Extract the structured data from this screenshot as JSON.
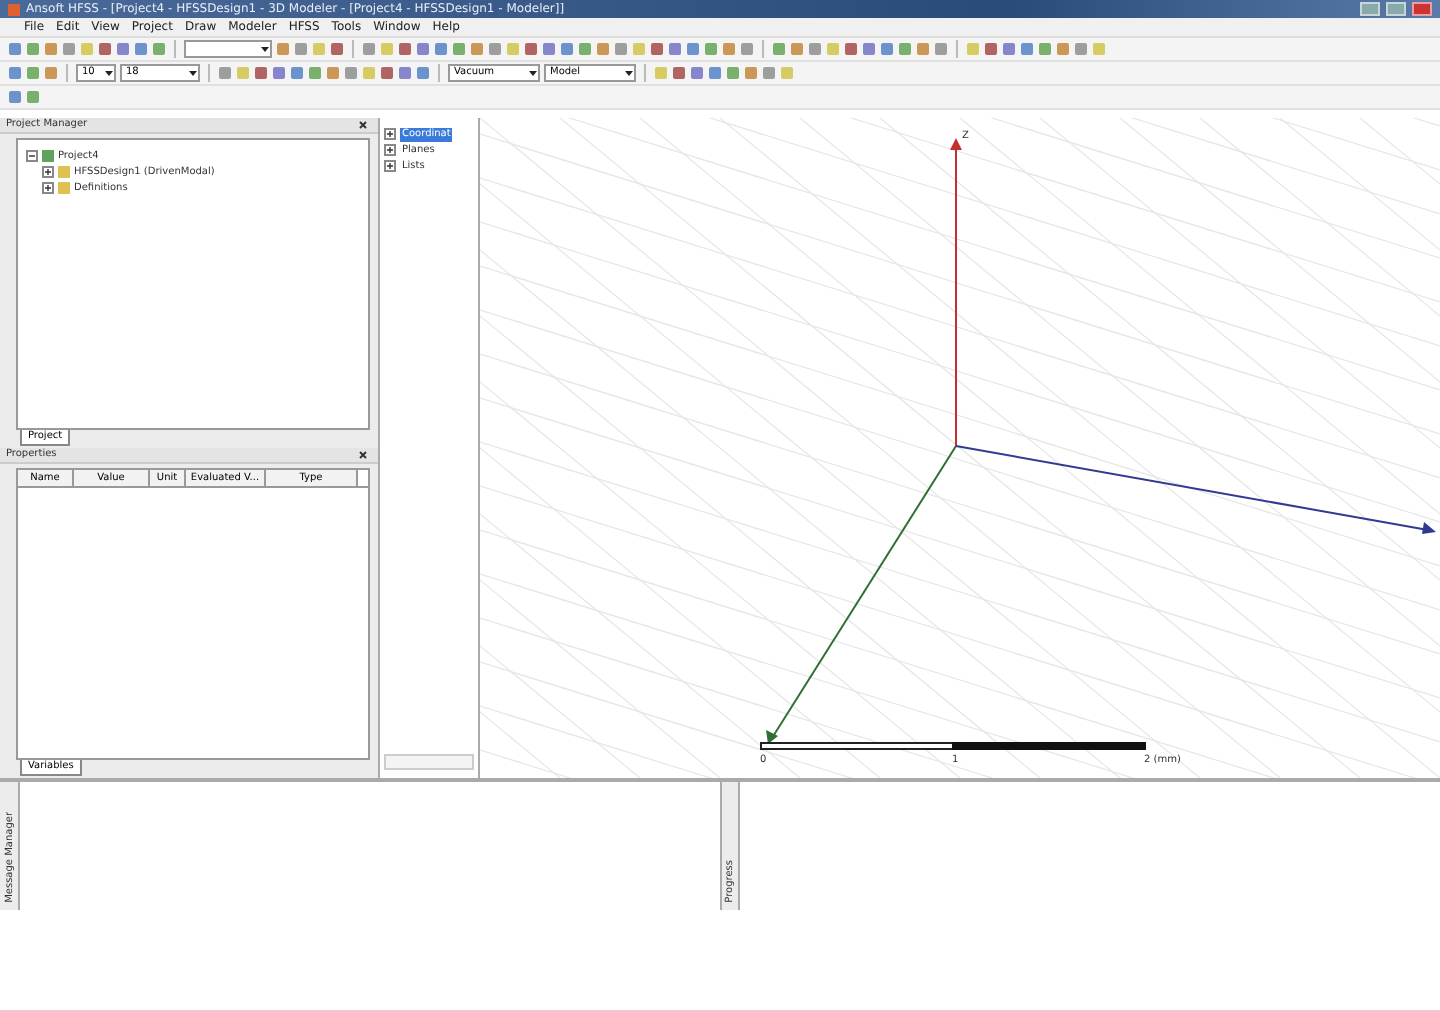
{
  "window": {
    "title": "Ansoft HFSS - [Project4 - HFSSDesign1 - 3D Modeler - [Project4 - HFSSDesign1 - Modeler]]"
  },
  "menu": [
    "File",
    "Edit",
    "View",
    "Project",
    "Draw",
    "Modeler",
    "HFSS",
    "Tools",
    "Window",
    "Help"
  ],
  "toolbar": {
    "combo_2": "10",
    "combo_3": "18",
    "material": "Vacuum",
    "mode": "Model"
  },
  "project_manager": {
    "title": "Project Manager",
    "tree": [
      {
        "label": "Project4",
        "expanded": true,
        "children": [
          {
            "label": "HFSSDesign1 (DrivenModal)",
            "expanded": false
          },
          {
            "label": "Definitions",
            "expanded": false
          }
        ]
      }
    ],
    "tab": "Project"
  },
  "properties": {
    "title": "Properties",
    "columns": [
      "Name",
      "Value",
      "Unit",
      "Evaluated V...",
      "Type"
    ],
    "tab": "Variables"
  },
  "model_tree": [
    {
      "label": "Coordinat",
      "selected": true
    },
    {
      "label": "Planes",
      "selected": false
    },
    {
      "label": "Lists",
      "selected": false
    }
  ],
  "viewport": {
    "axis_label": "Z",
    "scale": [
      "0",
      "1",
      "2 (mm)"
    ]
  },
  "message_manager": {
    "title": "Message Manager"
  },
  "progress": {
    "title": "Progress"
  }
}
